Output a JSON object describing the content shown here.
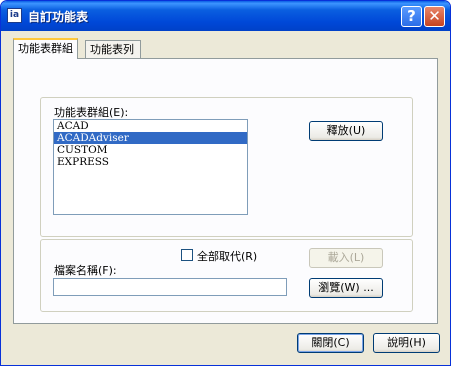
{
  "window": {
    "title": "自訂功能表"
  },
  "titlebar_buttons": {
    "help": "?",
    "close": "✕"
  },
  "tabs": [
    {
      "label": "功能表群組",
      "active": true
    },
    {
      "label": "功能表列",
      "active": false
    }
  ],
  "menu_groups": {
    "label": "功能表群組(E):",
    "items": [
      "ACAD",
      "ACADAdviser",
      "CUSTOM",
      "EXPRESS"
    ],
    "selected": "ACADAdviser",
    "unload_button": "釋放(U)"
  },
  "replace_all": {
    "label": "全部取代(R)",
    "checked": false
  },
  "load_button": "載入(L)",
  "file_name": {
    "label": "檔案名稱(F):",
    "value": ""
  },
  "browse_button": "瀏覽(W) ...",
  "footer": {
    "close_button": "關閉(C)",
    "help_button": "說明(H)"
  },
  "colors": {
    "titlebar": "#0a5fe0",
    "selection": "#316ac5",
    "tab_highlight": "#ffc83c"
  }
}
